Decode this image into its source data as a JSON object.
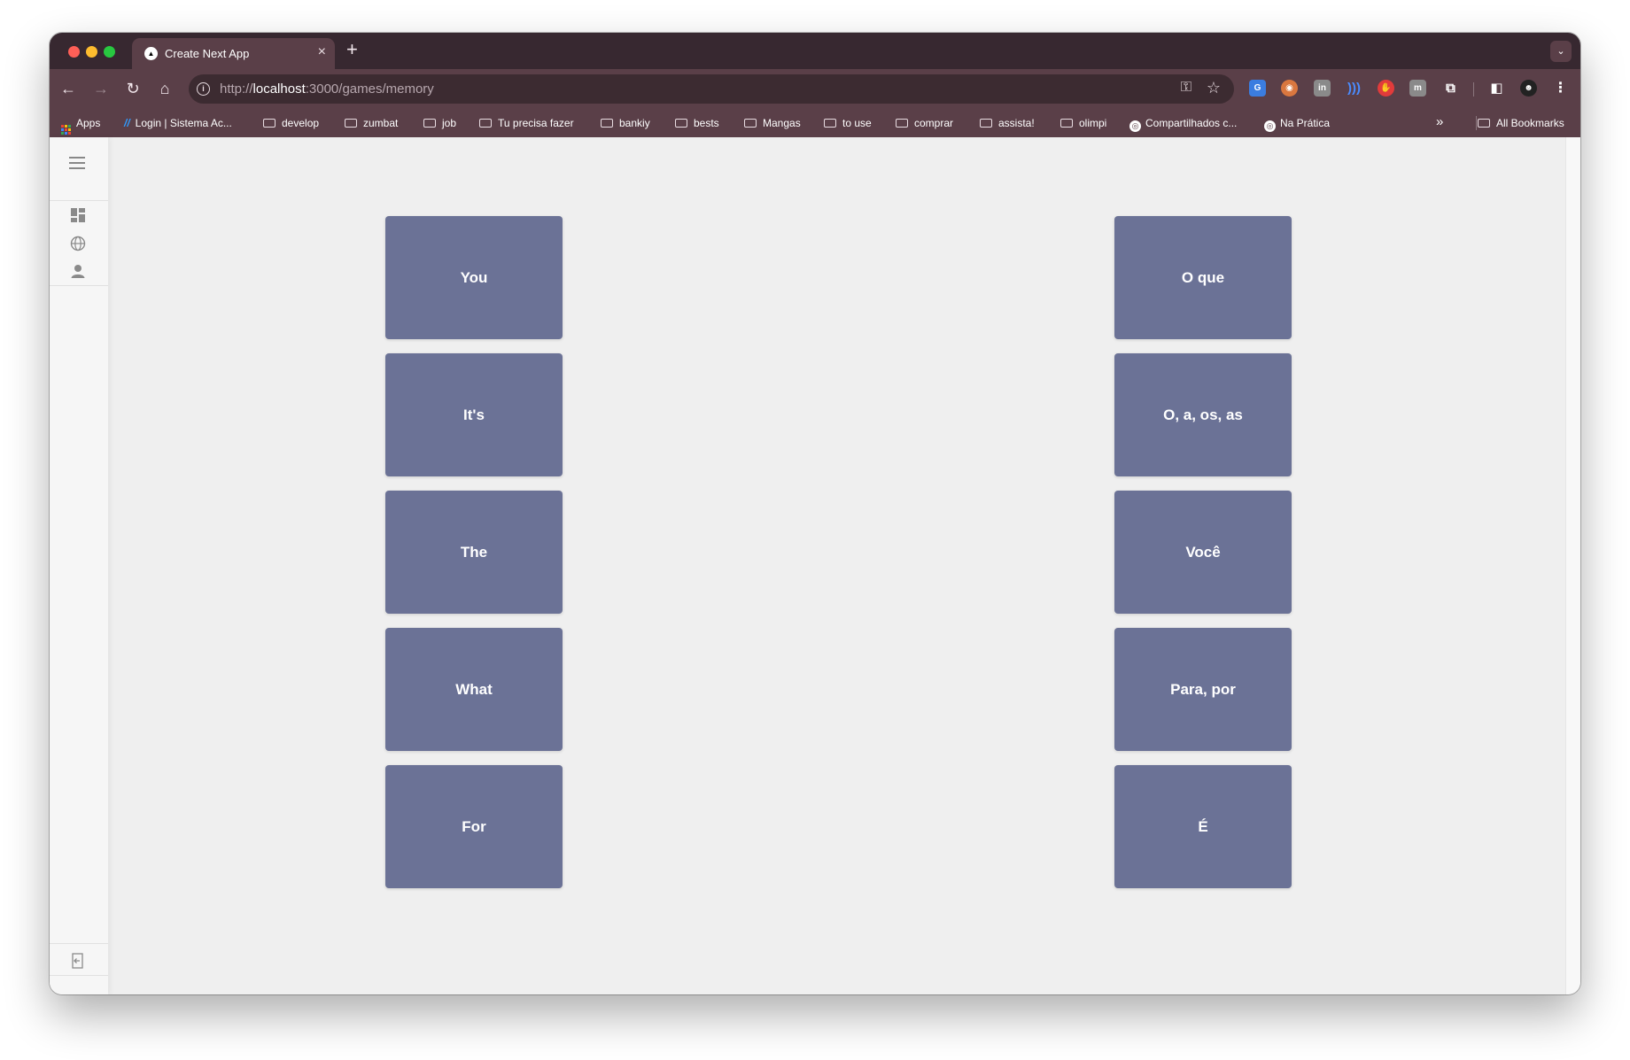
{
  "browser": {
    "tab_title": "Create Next App",
    "tab_close": "×",
    "new_tab": "+",
    "url_scheme": "http://",
    "url_host": "localhost",
    "url_path": ":3000/games/memory"
  },
  "bookmarks": [
    {
      "label": "Apps",
      "icon": "apps-grid-icon"
    },
    {
      "label": "Login | Sistema Ac...",
      "icon": "slash-icon"
    },
    {
      "label": "develop",
      "icon": "folder-icon"
    },
    {
      "label": "zumbat",
      "icon": "folder-icon"
    },
    {
      "label": "job",
      "icon": "folder-icon"
    },
    {
      "label": "Tu precisa fazer",
      "icon": "folder-icon"
    },
    {
      "label": "bankiy",
      "icon": "folder-icon"
    },
    {
      "label": "bests",
      "icon": "folder-icon"
    },
    {
      "label": "Mangas",
      "icon": "folder-icon"
    },
    {
      "label": "to use",
      "icon": "folder-icon"
    },
    {
      "label": "comprar",
      "icon": "folder-icon"
    },
    {
      "label": "assista!",
      "icon": "folder-icon"
    },
    {
      "label": "olimpi",
      "icon": "folder-icon"
    },
    {
      "label": "Compartilhados c...",
      "icon": "globe-icon"
    },
    {
      "label": "Na Prática",
      "icon": "globe-icon"
    }
  ],
  "bookmarks_overflow": "»",
  "all_bookmarks": "All Bookmarks",
  "cards_left": [
    "You",
    "It's",
    "The",
    "What",
    "For"
  ],
  "cards_right": [
    "O que",
    "O, a, os, as",
    "Você",
    "Para, por",
    "É"
  ],
  "colors": {
    "card": "#6b7296",
    "page_bg": "#efefef",
    "chrome_dark": "#372830",
    "chrome": "#5a3f48"
  }
}
